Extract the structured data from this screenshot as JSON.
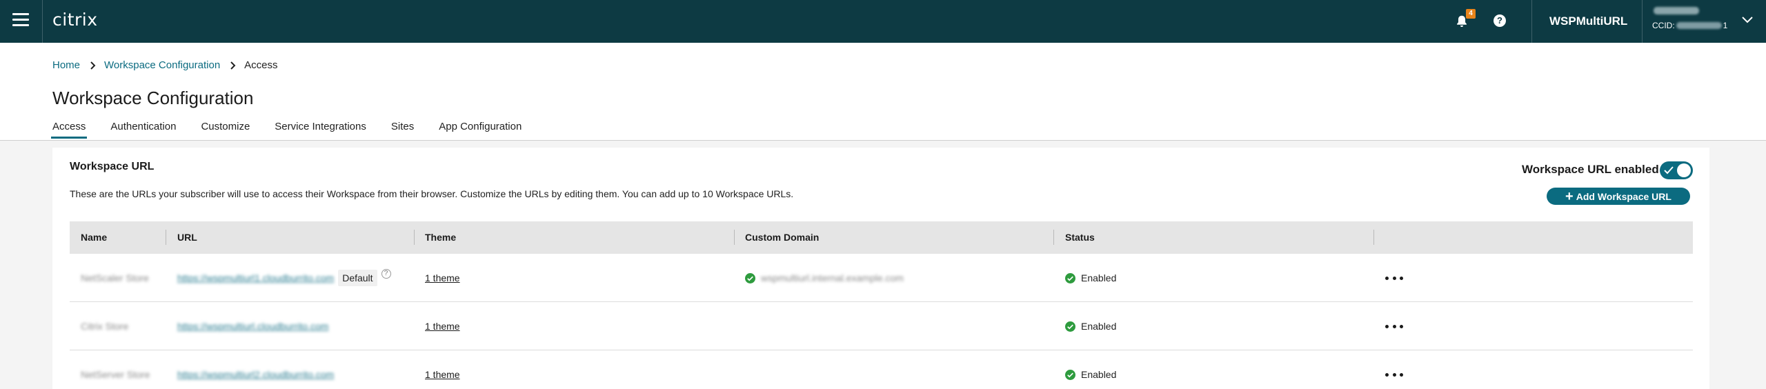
{
  "topbar": {
    "brand": "citrix",
    "notification_count": "4",
    "help_glyph": "?",
    "account_name": "WSPMultiURL",
    "ccid_prefix": "CCID: ",
    "ccid_suffix": "1",
    "icons": [
      "menu-icon",
      "bell-icon",
      "help-icon",
      "chevron-down-icon"
    ]
  },
  "breadcrumb": {
    "home": "Home",
    "section": "Workspace Configuration",
    "current": "Access"
  },
  "page": {
    "title": "Workspace Configuration"
  },
  "tabs": [
    {
      "label": "Access",
      "active": true
    },
    {
      "label": "Authentication",
      "active": false
    },
    {
      "label": "Customize",
      "active": false
    },
    {
      "label": "Service Integrations",
      "active": false
    },
    {
      "label": "Sites",
      "active": false
    },
    {
      "label": "App Configuration",
      "active": false
    }
  ],
  "card": {
    "title": "Workspace URL",
    "description": "These are the URLs your subscriber will use to access their Workspace from their browser. Customize the URLs by editing them. You can add up to 10 Workspace URLs.",
    "toggle_label": "Workspace URL enabled",
    "toggle_on": true,
    "add_button": "Add Workspace URL"
  },
  "table": {
    "columns": [
      "Name",
      "URL",
      "Theme",
      "Custom Domain",
      "Status"
    ],
    "rows": [
      {
        "name": "NetScaler Store",
        "url": "https://wspmultiurl1.cloudburrito.com",
        "default_label": "Default",
        "theme": "1 theme",
        "custom_domain": "wspmultiurl.internal.example.com",
        "status": "Enabled"
      },
      {
        "name": "Citrix Store",
        "url": "https://wspmultiurl.cloudburrito.com",
        "theme": "1 theme",
        "custom_domain": "",
        "status": "Enabled"
      },
      {
        "name": "NetServer Store",
        "url": "https://wspmultiurl2.cloudburrito.com",
        "theme": "1 theme",
        "custom_domain": "",
        "status": "Enabled"
      }
    ]
  },
  "colors": {
    "topbar_bg": "#0d3a43",
    "accent": "#0b6b80",
    "success": "#2e9b3e",
    "badge": "#e8841b"
  }
}
